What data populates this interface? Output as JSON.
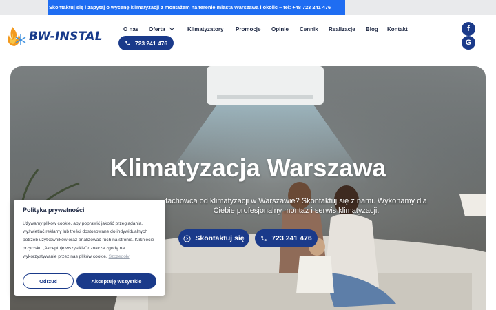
{
  "topbar": {
    "message": "Skontaktuj się i zapytaj o wycenę klimatyzacji z montażem na terenie miasta Warszawa i okolic – tel: +48 723 241 476"
  },
  "header": {
    "logo_text": "BW-INSTAL",
    "nav": [
      {
        "label": "O nas"
      },
      {
        "label": "Oferta",
        "has_dropdown": true
      },
      {
        "label": "Klimatyzatory"
      },
      {
        "label": "Promocje"
      },
      {
        "label": "Opinie"
      },
      {
        "label": "Cennik"
      },
      {
        "label": "Realizacje"
      },
      {
        "label": "Blog"
      },
      {
        "label": "Kontakt"
      }
    ],
    "phone_label": "723 241 476",
    "social": {
      "facebook_glyph": "f",
      "google_glyph": "G"
    }
  },
  "hero": {
    "title": "Klimatyzacja Warszawa",
    "subtitle": "fachowca od klimatyzacji w Warszawie? Skontaktuj się z nami. Wykonamy dla Ciebie profesjonalny montaż i serwis klimatyzacji.",
    "contact_button": "Skontaktuj się",
    "phone_button": "723 241 476"
  },
  "cookie": {
    "title": "Polityka prywatności",
    "text": "Używamy plików cookie, aby poprawić jakość przeglądania, wyświetlać reklamy lub treści dostosowane do indywidualnych potrzeb użytkowników oraz analizować ruch na stronie. Kliknięcie przycisku „Akceptuję wszystkie” oznacza zgodę na wykorzystywanie przez nas plików cookie.",
    "link": "Szczegóły",
    "reject_button": "Odrzuć",
    "accept_button": "Akceptuję wszystkie"
  },
  "colors": {
    "brand_navy": "#1a3a8a",
    "topbar_blue": "#1f6df2",
    "flame_orange": "#f39a1e",
    "snow_blue": "#3a8fe0"
  }
}
